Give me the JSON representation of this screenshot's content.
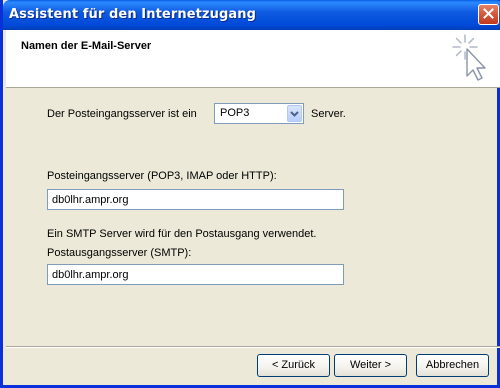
{
  "window": {
    "title": "Assistent für den Internetzugang",
    "close_icon": "close-icon"
  },
  "header": {
    "title": "Namen der E-Mail-Server",
    "icon": "wizard-cursor-icon"
  },
  "incoming_type": {
    "prefix": "Der Posteingangsserver ist ein",
    "selected": "POP3",
    "suffix": "Server."
  },
  "incoming_server": {
    "label": "Posteingangsserver (POP3, IMAP oder HTTP):",
    "value": "db0lhr.ampr.org"
  },
  "smtp_note": "Ein SMTP Server wird für den Postausgang verwendet.",
  "outgoing_server": {
    "label": "Postausgangsserver (SMTP):",
    "value": "db0lhr.ampr.org"
  },
  "buttons": {
    "back": "< Zurück",
    "next": "Weiter >",
    "cancel": "Abbrechen"
  },
  "colors": {
    "titlebar": "#0054E3",
    "dialog_bg": "#ECE9D8",
    "close_button": "#D45B3D"
  }
}
